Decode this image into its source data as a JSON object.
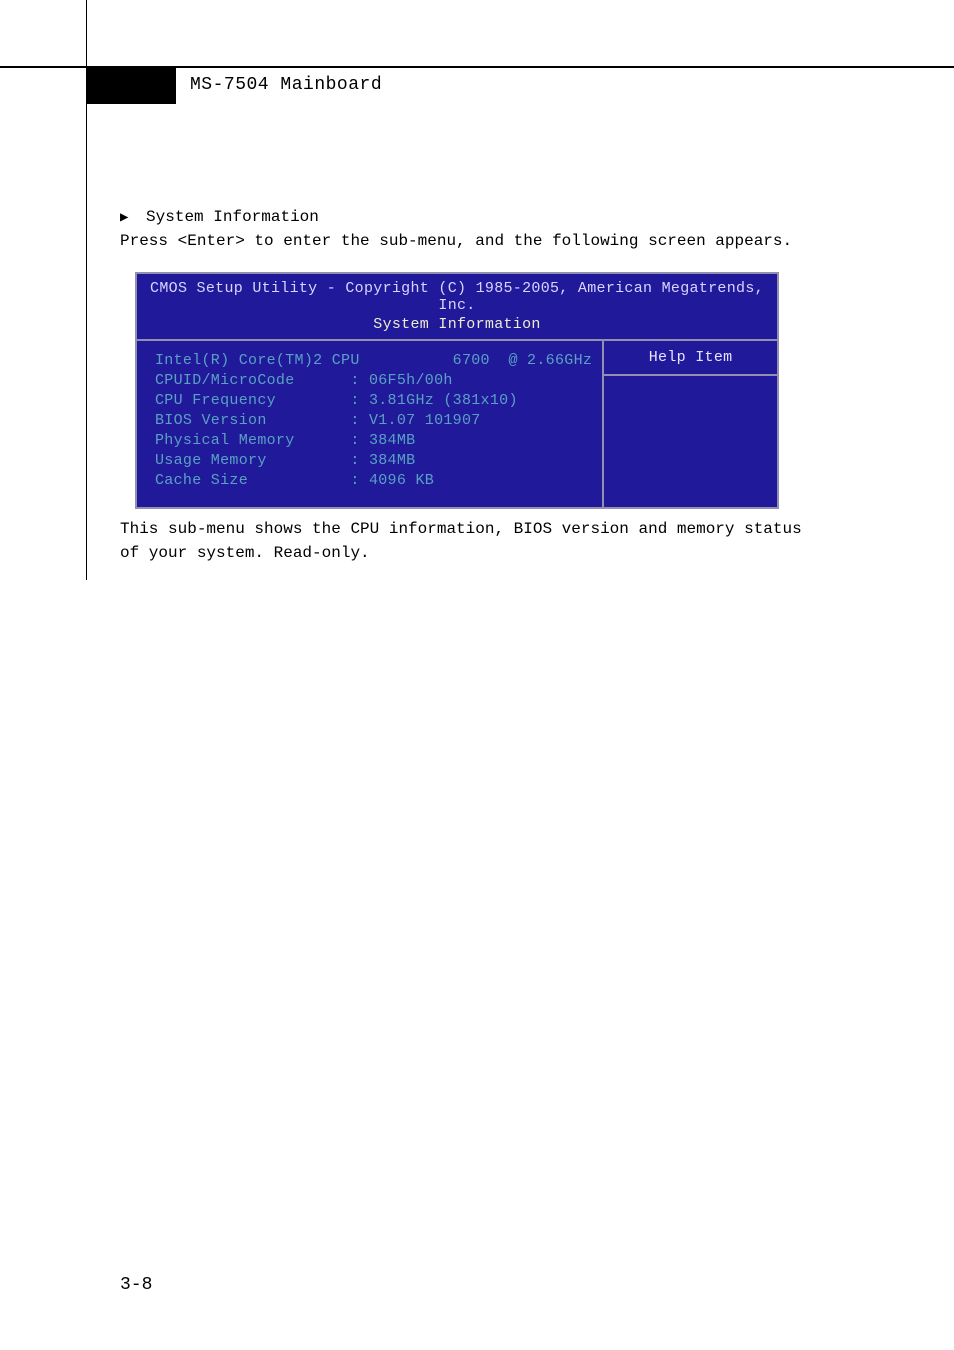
{
  "header": {
    "title": "MS-7504 Mainboard"
  },
  "section": {
    "arrow": "▶",
    "heading": "System Information",
    "press_line": "Press <Enter> to enter the sub-menu, and the following screen appears.",
    "desc1": "This sub-menu shows the CPU information, BIOS version and memory status",
    "desc2": "of your system. Read-only."
  },
  "page_number": "3-8",
  "bios": {
    "title": "CMOS Setup Utility - Copyright (C) 1985-2005, American Megatrends, Inc.",
    "subtitle": "System Information",
    "help_item": "Help Item",
    "cpu_line": "Intel(R) Core(TM)2 CPU          6700  @ 2.66GHz",
    "rows": [
      {
        "label": "CPUID/MicroCode",
        "value": "06F5h/00h"
      },
      {
        "label": "CPU Frequency",
        "value": "3.81GHz (381x10)"
      },
      {
        "label": "BIOS Version",
        "value": "V1.07 101907"
      },
      {
        "label": "Physical Memory",
        "value": "384MB"
      },
      {
        "label": "Usage Memory",
        "value": "384MB"
      },
      {
        "label": "Cache Size",
        "value": "4096 KB"
      }
    ]
  }
}
